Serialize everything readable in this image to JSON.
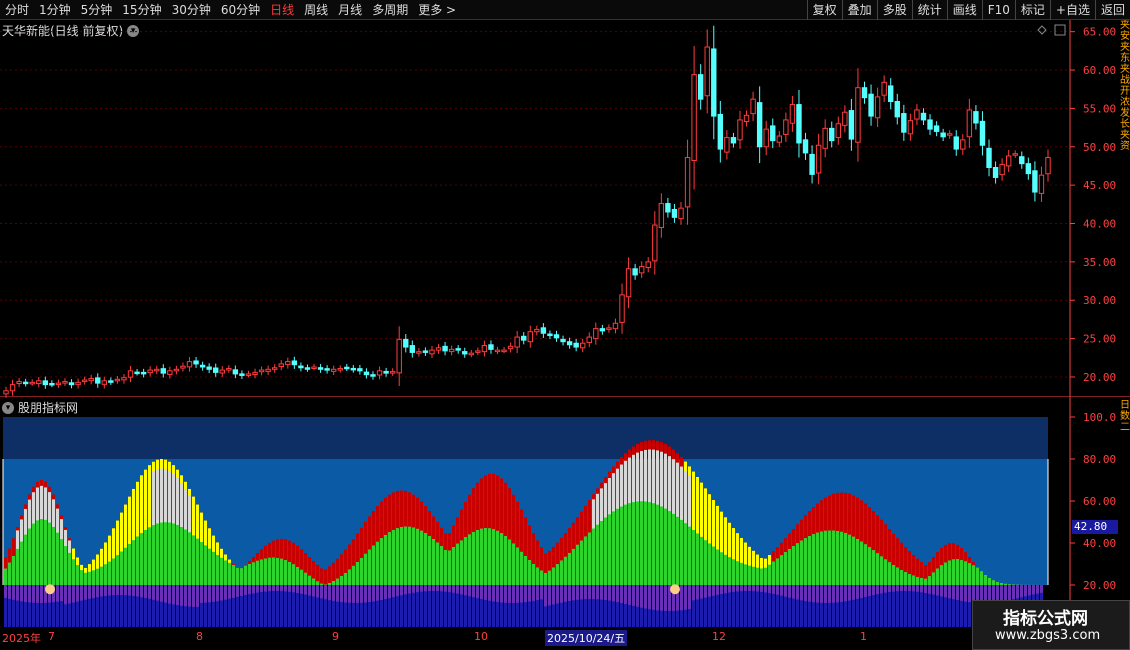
{
  "toolbar": {
    "periods": [
      "分时",
      "1分钟",
      "5分钟",
      "15分钟",
      "30分钟",
      "60分钟",
      "日线",
      "周线",
      "月线",
      "多周期",
      "更多 >"
    ],
    "active": "日线",
    "right": [
      "复权",
      "叠加",
      "多股",
      "统计",
      "画线",
      "F10",
      "标记",
      "+自选",
      "返回"
    ]
  },
  "main": {
    "title": "天华新能(日线 前复权)",
    "y_labels": [
      "65.00",
      "60.00",
      "55.00",
      "50.00",
      "45.00",
      "40.00",
      "35.00",
      "30.00",
      "25.00",
      "20.00"
    ],
    "side_text": "夹安夹东夹战开浓发长夹资"
  },
  "indicator": {
    "title": "股朋指标网",
    "y_labels": [
      "100.0",
      "80.00",
      "60.00",
      "40.00",
      "20.00"
    ],
    "current_value": "42.80",
    "side_text": "日数二"
  },
  "date_axis": [
    {
      "label": "2025年",
      "hl": false
    },
    {
      "label": "7",
      "hl": false
    },
    {
      "label": "8",
      "hl": false
    },
    {
      "label": "9",
      "hl": false
    },
    {
      "label": "10",
      "hl": false
    },
    {
      "label": "2025/10/24/五",
      "hl": true
    },
    {
      "label": "12",
      "hl": false
    },
    {
      "label": "1",
      "hl": false
    }
  ],
  "watermark": {
    "line1": "指标公式网",
    "line2": "www.zbgs3.com"
  },
  "colors": {
    "up": "#ff3c3c",
    "down": "#54ffff",
    "axis": "#ff4040",
    "ind_bg_top": "#0d2f66",
    "ind_bg": "#0b5aa6",
    "indigo": "#1c1cb0",
    "purple": "#6a2fb8",
    "red": "#c80000",
    "green": "#2cd42c",
    "yellow": "#ffff00",
    "white": "#d8d8d8"
  },
  "chart_data": {
    "type": "candlestick",
    "ylim": [
      17,
      66
    ],
    "closes": [
      18.2,
      19.0,
      19.4,
      19.2,
      19.3,
      19.5,
      19.0,
      19.1,
      19.2,
      19.4,
      19.0,
      19.3,
      19.6,
      19.8,
      19.2,
      19.5,
      19.4,
      19.7,
      19.9,
      20.8,
      20.6,
      20.4,
      20.9,
      21.0,
      20.5,
      20.8,
      21.0,
      21.4,
      22.0,
      21.7,
      21.3,
      21.0,
      20.6,
      20.9,
      21.1,
      20.4,
      20.2,
      20.4,
      20.6,
      20.9,
      21.0,
      21.2,
      21.7,
      22.0,
      21.6,
      21.2,
      21.1,
      21.3,
      21.0,
      20.9,
      21.0,
      21.1,
      21.2,
      21.0,
      20.8,
      20.3,
      20.1,
      20.8,
      20.5,
      20.7,
      24.9,
      23.9,
      23.2,
      23.3,
      23.2,
      23.5,
      23.8,
      23.4,
      23.6,
      23.5,
      23.0,
      23.1,
      23.4,
      24.1,
      23.6,
      23.5,
      23.5,
      24.0,
      25.2,
      24.8,
      25.9,
      26.2,
      25.7,
      25.4,
      25.1,
      24.6,
      24.2,
      23.9,
      24.4,
      25.2,
      26.3,
      26.0,
      26.4,
      27.0,
      30.7,
      34.1,
      33.3,
      34.4,
      35.0,
      39.8,
      42.6,
      41.5,
      40.8,
      42.0,
      48.6,
      59.4,
      56.2,
      63.0,
      54.0,
      49.7,
      51.2,
      50.5,
      53.5,
      54.1,
      56.2,
      50.0,
      52.3,
      50.8,
      51.4,
      53.5,
      55.5,
      50.5,
      49.2,
      46.4,
      50.2,
      52.4,
      50.8,
      53.0,
      54.5,
      51.0,
      57.7,
      56.4,
      54.0,
      56.5,
      58.4,
      55.9,
      53.9,
      51.9,
      53.4,
      54.8,
      53.5,
      52.3,
      52.0,
      51.3,
      51.7,
      49.7,
      50.9,
      54.8,
      53.1,
      50.2,
      47.3,
      46.0,
      47.7,
      48.8,
      49.1,
      47.8,
      46.5,
      44.1,
      46.3,
      48.6
    ]
  }
}
